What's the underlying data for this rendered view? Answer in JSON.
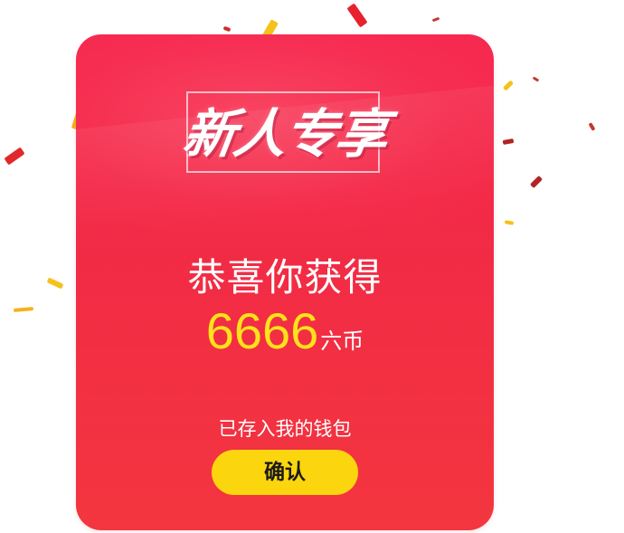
{
  "dialog": {
    "title": "新人专享",
    "congrats_text": "恭喜你获得",
    "reward_amount": "6666",
    "reward_unit": "六币",
    "saved_text": "已存入我的钱包",
    "confirm_label": "确认"
  },
  "colors": {
    "card_background": "#f32a47",
    "amount_color": "#ffe21a",
    "button_color": "#fbd50e",
    "button_text": "#1a1a1a",
    "text_color": "#ffffff"
  }
}
